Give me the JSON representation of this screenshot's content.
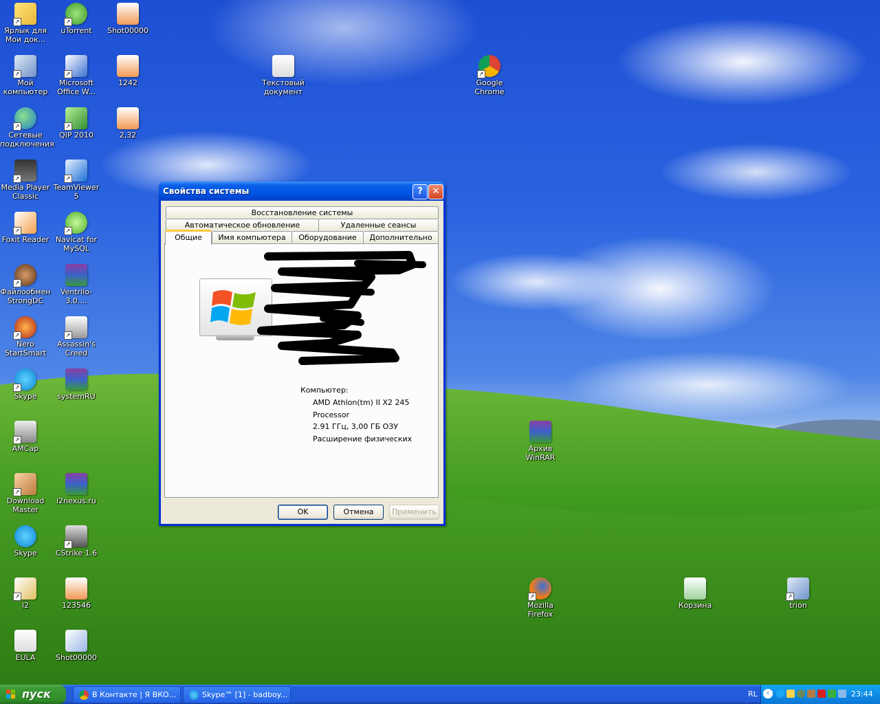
{
  "desktop": {
    "icons": [
      {
        "label": "Ярлык для Мои док..."
      },
      {
        "label": "uTorrent"
      },
      {
        "label": "Shot00000"
      },
      {
        "label": "Мой компьютер"
      },
      {
        "label": "Microsoft Office W..."
      },
      {
        "label": "1242"
      },
      {
        "label": "Текстовый документ"
      },
      {
        "label": "Google Chrome"
      },
      {
        "label": "Сетевые подключения"
      },
      {
        "label": "QIP 2010"
      },
      {
        "label": "2,32"
      },
      {
        "label": "Media Player Classic"
      },
      {
        "label": "TeamViewer 5"
      },
      {
        "label": "Foxit Reader"
      },
      {
        "label": "Navicat for MySQL"
      },
      {
        "label": "Файлообмен StrongDC"
      },
      {
        "label": "Ventrilo-3.0...."
      },
      {
        "label": "Nero StartSmart"
      },
      {
        "label": "Assassin's Creed"
      },
      {
        "label": "Skype"
      },
      {
        "label": "systemRU"
      },
      {
        "label": "AMCap"
      },
      {
        "label": "Архив WinRAR"
      },
      {
        "label": "Download Master"
      },
      {
        "label": "l2nexus.ru"
      },
      {
        "label": "Skype"
      },
      {
        "label": "CStrike 1.6"
      },
      {
        "label": "l2"
      },
      {
        "label": "123546"
      },
      {
        "label": "Mozilla Firefox"
      },
      {
        "label": "Корзина"
      },
      {
        "label": "trion"
      },
      {
        "label": "EULA"
      },
      {
        "label": "Shot00000"
      }
    ]
  },
  "dialog": {
    "title": "Свойства системы",
    "help_glyph": "?",
    "close_glyph": "✕",
    "tabs": {
      "row1": [
        "Восстановление системы"
      ],
      "row2": [
        "Автоматическое обновление",
        "Удаленные сеансы"
      ],
      "row3": [
        "Общие",
        "Имя компьютера",
        "Оборудование",
        "Дополнительно"
      ]
    },
    "active_tab": "Общие",
    "computer_label": "Компьютер:",
    "cpu_line1": "AMD Athlon(tm) II X2 245",
    "cpu_line2": "Processor",
    "cpu_line3": "2.91 ГГц, 3,00 ГБ ОЗУ",
    "cpu_line4": "Расширение физических",
    "buttons": {
      "ok": "OK",
      "cancel": "Отмена",
      "apply": "Применить"
    }
  },
  "taskbar": {
    "start_label": "пуск",
    "tasks": [
      {
        "label": "В Контакте | Я ВКО..."
      },
      {
        "label": "Skype™ [1] - badboy..."
      }
    ],
    "language": "RL",
    "clock": "23:44"
  }
}
